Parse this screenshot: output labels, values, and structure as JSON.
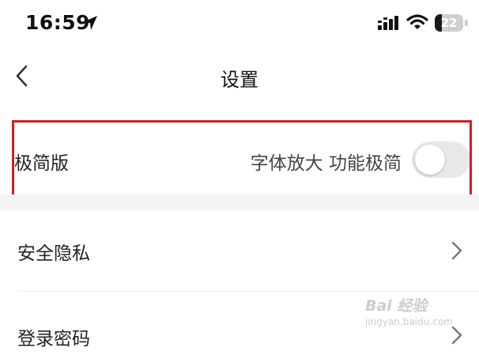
{
  "status_bar": {
    "time": "16:59",
    "battery_percent": "22",
    "icons": [
      "location-arrow-icon",
      "cellular-signal-icon",
      "wifi-icon",
      "battery-icon"
    ]
  },
  "nav": {
    "title": "设置",
    "back_icon": "chevron-left-icon"
  },
  "settings": {
    "minimal": {
      "label": "极简版",
      "hint": "字体放大 功能极简",
      "toggle_on": false
    },
    "security": {
      "label": "安全隐私"
    },
    "password": {
      "label": "登录密码"
    }
  },
  "watermark": {
    "text": "Bai 经验",
    "url": "jingyan.baidu.com"
  },
  "colors": {
    "highlight": "#d41c1c",
    "toggle_off": "#e8e8e8",
    "section_gap": "#f4f4f4"
  }
}
